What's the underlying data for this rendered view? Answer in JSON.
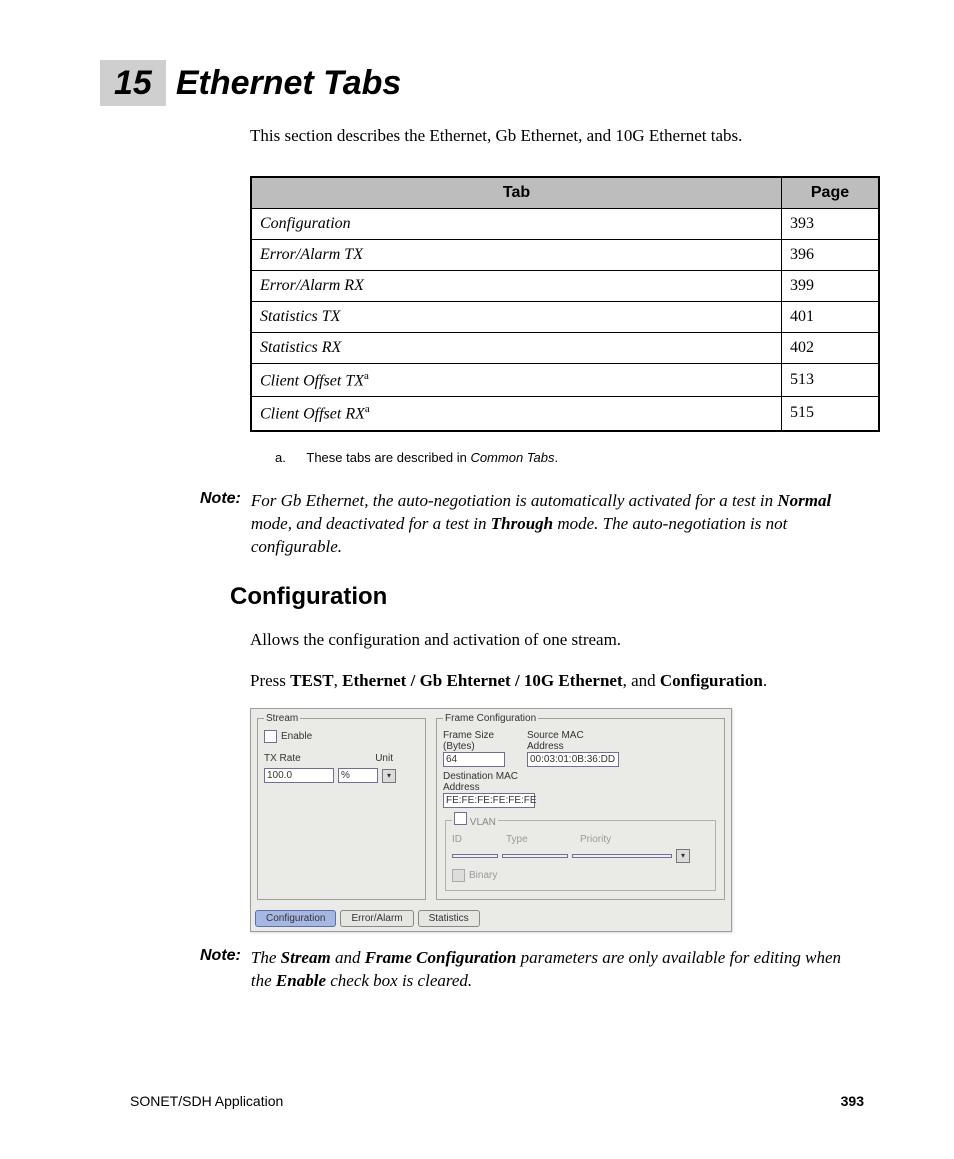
{
  "chapter": {
    "number": "15",
    "title": "Ethernet Tabs"
  },
  "intro": "This section describes the Ethernet, Gb Ethernet, and 10G Ethernet tabs.",
  "table": {
    "headers": {
      "tab": "Tab",
      "page": "Page"
    },
    "rows": [
      {
        "tab": "Configuration",
        "sup": "",
        "page": "393"
      },
      {
        "tab": "Error/Alarm TX",
        "sup": "",
        "page": "396"
      },
      {
        "tab": "Error/Alarm RX",
        "sup": "",
        "page": "399"
      },
      {
        "tab": "Statistics TX",
        "sup": "",
        "page": "401"
      },
      {
        "tab": "Statistics RX",
        "sup": "",
        "page": "402"
      },
      {
        "tab": "Client Offset TX",
        "sup": "a",
        "page": "513"
      },
      {
        "tab": "Client Offset RX",
        "sup": "a",
        "page": "515"
      }
    ]
  },
  "footnote": {
    "label": "a.",
    "text": "These tabs are described in ",
    "ital": "Common Tabs",
    "tail": "."
  },
  "note1": {
    "label": "Note:",
    "pre": "For Gb Ethernet, the auto-negotiation is automatically activated for a test in ",
    "b1": "Normal",
    "mid": " mode, and deactivated for a test in ",
    "b2": "Through",
    "post": " mode. The auto-negotiation is not configurable."
  },
  "section": {
    "title": "Configuration"
  },
  "body1": "Allows the configuration and activation of one stream.",
  "body2": {
    "pre": "Press ",
    "b1": "TEST",
    "sep1": ", ",
    "b2": "Ethernet / Gb Ehternet / 10G Ethernet",
    "sep2": ", and ",
    "b3": "Configuration",
    "tail": "."
  },
  "shot": {
    "stream": {
      "legend": "Stream",
      "enable": "Enable",
      "txrate": "TX Rate",
      "unit": "Unit",
      "txrate_val": "100.0",
      "unit_val": "%"
    },
    "frame": {
      "legend": "Frame Configuration",
      "fs_label": "Frame Size (Bytes)",
      "fs_val": "64",
      "src_label": "Source MAC Address",
      "src_val": "00:03:01:0B:36:DD",
      "dst_label": "Destination MAC Address",
      "dst_val": "FE:FE:FE:FE:FE:FE",
      "vlan": {
        "legend": "VLAN",
        "id": "ID",
        "type": "Type",
        "priority": "Priority",
        "binary": "Binary"
      }
    },
    "tabs": {
      "configuration": "Configuration",
      "erroralarm": "Error/Alarm",
      "statistics": "Statistics"
    }
  },
  "note2": {
    "label": "Note:",
    "pre": "The ",
    "b1": "Stream",
    "mid1": " and ",
    "b2": "Frame Configuration",
    "mid2": " parameters are only available for editing when the ",
    "b3": "Enable",
    "post": " check box is cleared."
  },
  "footer": {
    "app": "SONET/SDH Application",
    "page": "393"
  }
}
